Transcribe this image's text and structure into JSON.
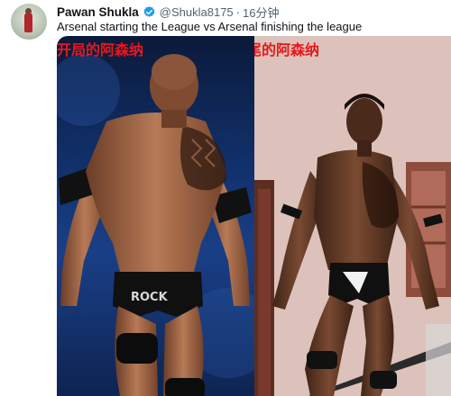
{
  "post": {
    "author_name": "Pawan Shukla",
    "handle": "@Shukla8175",
    "separator": "·",
    "time": "16分钟",
    "text": "Arsenal starting the League vs Arsenal finishing the league",
    "verified_color": "#1d9bf0"
  },
  "media": {
    "left_caption": "开局的阿森纳",
    "right_caption": "结尾的阿森纳",
    "trunks_text": "ROCK",
    "caption_color": "#e8171c"
  }
}
